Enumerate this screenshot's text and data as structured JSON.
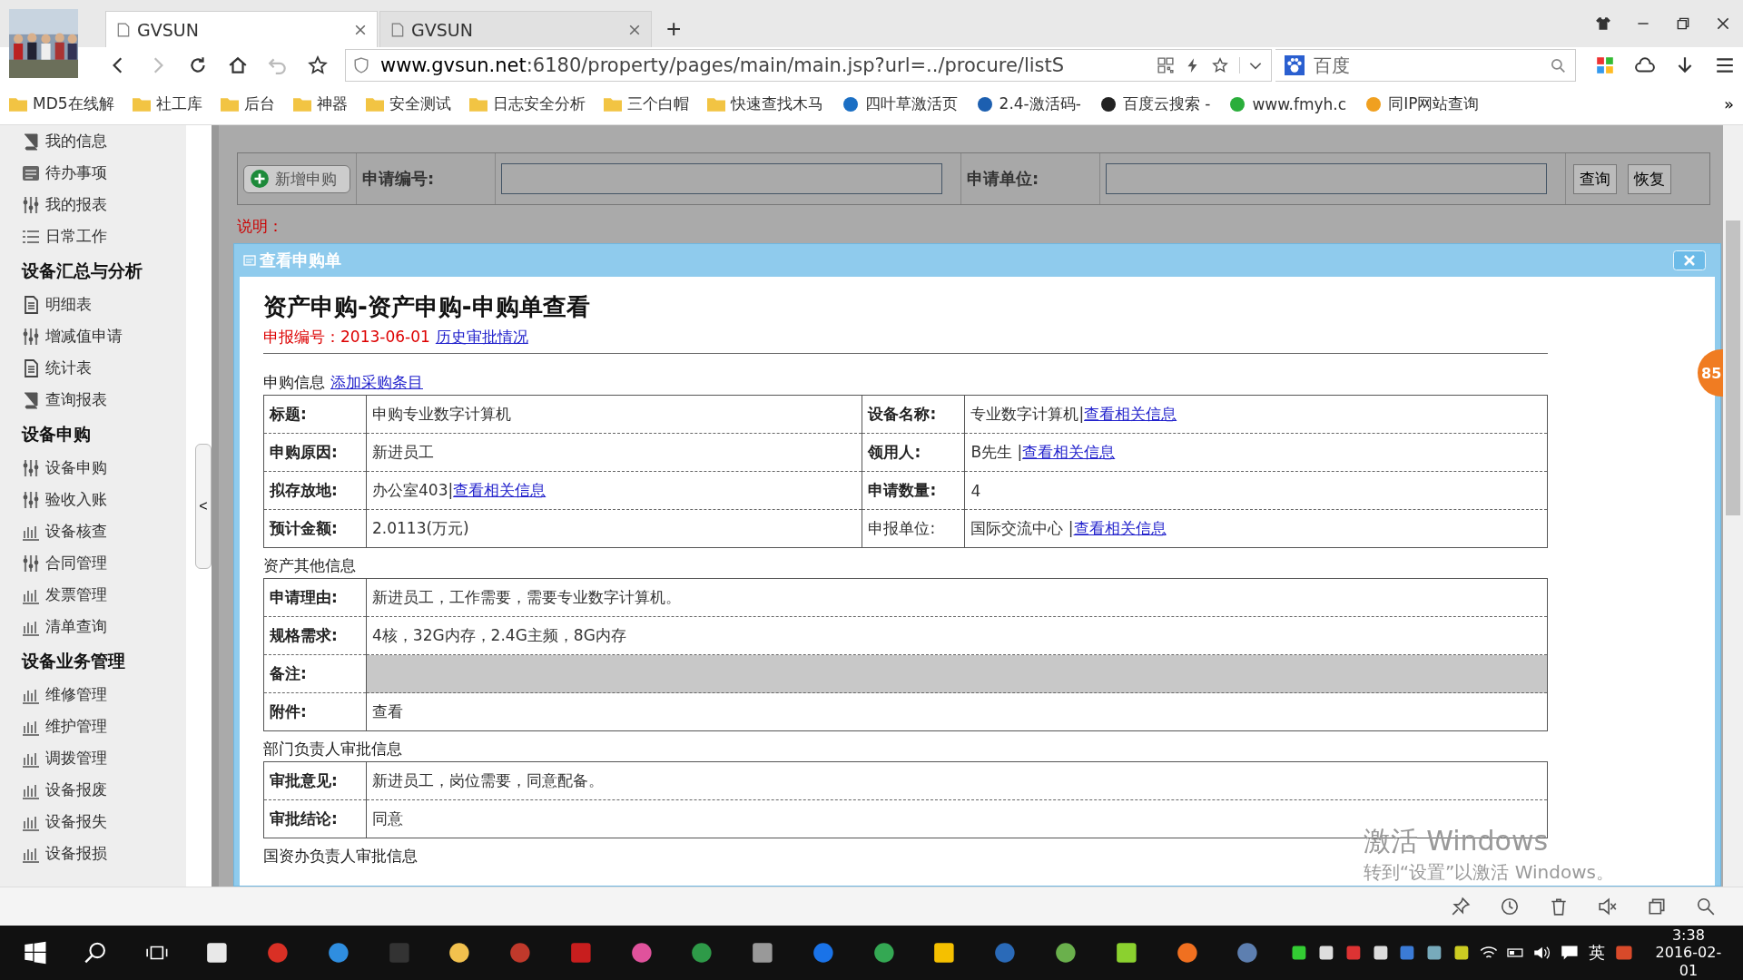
{
  "browser": {
    "tabs": [
      {
        "title": "GVSUN",
        "selected": true
      },
      {
        "title": "GVSUN",
        "selected": false
      }
    ],
    "new_tab": "+",
    "address": {
      "host": "www.gvsun.net",
      "path": ":6180/property/pages/main/main.jsp?url=../procure/listS"
    },
    "search": {
      "value": "百度"
    },
    "bookmarks": [
      {
        "label": "MD5在线解",
        "kind": "folder"
      },
      {
        "label": "社工库",
        "kind": "folder"
      },
      {
        "label": "后台",
        "kind": "folder"
      },
      {
        "label": "神器",
        "kind": "folder"
      },
      {
        "label": "安全测试",
        "kind": "folder"
      },
      {
        "label": "日志安全分析",
        "kind": "folder"
      },
      {
        "label": "三个白帽",
        "kind": "folder"
      },
      {
        "label": "快速查找木马",
        "kind": "folder"
      },
      {
        "label": "四叶草激活页",
        "kind": "site"
      },
      {
        "label": "2.4-激活码-",
        "kind": "site"
      },
      {
        "label": "百度云搜索 -",
        "kind": "site"
      },
      {
        "label": "www.fmyh.c",
        "kind": "site"
      },
      {
        "label": "同IP网站查询",
        "kind": "site"
      }
    ],
    "more": "»"
  },
  "sidebar": {
    "groups": [
      {
        "items": [
          "我的信息",
          "待办事项",
          "我的报表",
          "日常工作"
        ]
      },
      {
        "heading": "设备汇总与分析",
        "items": [
          "明细表",
          "增减值申请",
          "统计表",
          "查询报表"
        ]
      },
      {
        "heading": "设备申购",
        "items": [
          "设备申购",
          "验收入账",
          "设备核查",
          "合同管理",
          "发票管理",
          "清单查询"
        ]
      },
      {
        "heading": "设备业务管理",
        "items": [
          "维修管理",
          "维护管理",
          "调拨管理",
          "设备报废",
          "设备报失",
          "设备报损"
        ]
      }
    ],
    "collapse": "<"
  },
  "filter": {
    "add_button": "新增申购",
    "fields": [
      {
        "label": "申请编号:"
      },
      {
        "label": "申请单位:"
      }
    ],
    "buttons": [
      "查询",
      "恢复"
    ]
  },
  "note_label": "说明：",
  "dialog": {
    "title": "查看申购单",
    "heading": "资产申购-资产申购-申购单查看",
    "code": "申报编号：2013-06-01",
    "history_link": "历史审批情况",
    "sections": [
      {
        "kind": "grid4",
        "title": "申购信息",
        "link": "添加采购条目",
        "rows": [
          {
            "cells": [
              {
                "label": "标题:",
                "bold": true,
                "value": "申购专业数字计算机"
              },
              {
                "label": "设备名称:",
                "bold": true,
                "value": "专业数字计算机|",
                "link": "查看相关信息"
              }
            ]
          },
          {
            "cells": [
              {
                "label": "申购原因:",
                "bold": true,
                "value": "新进员工"
              },
              {
                "label": "领用人:",
                "bold": true,
                "value": "B先生 |",
                "link": "查看相关信息"
              }
            ]
          },
          {
            "cells": [
              {
                "label": "拟存放地:",
                "bold": true,
                "value": "办公室403|",
                "link": "查看相关信息"
              },
              {
                "label": "申请数量:",
                "bold": true,
                "value": "4"
              }
            ]
          },
          {
            "cells": [
              {
                "label": "预计金额:",
                "bold": true,
                "value": "2.0113(万元)"
              },
              {
                "label": "申报单位:",
                "bold": false,
                "value": "国际交流中心 |",
                "link": "查看相关信息"
              }
            ]
          }
        ]
      },
      {
        "kind": "grid2",
        "title": "资产其他信息",
        "rows": [
          {
            "label": "申请理由:",
            "value": "新进员工，工作需要，需要专业数字计算机。",
            "shaded": false
          },
          {
            "label": "规格需求:",
            "value": "4核，32G内存，2.4G主频，8G内存",
            "shaded": false
          },
          {
            "label": "备注:",
            "shaded": true
          },
          {
            "label": "附件:",
            "value": "查看",
            "shaded": false
          }
        ]
      },
      {
        "kind": "grid2",
        "title": "部门负责人审批信息",
        "rows": [
          {
            "label": "审批意见:",
            "value": "新进员工，岗位需要，同意配备。",
            "shaded": false
          },
          {
            "label": "审批结论:",
            "value": "同意",
            "shaded": false
          }
        ]
      },
      {
        "kind": "heading",
        "title": "国资办负责人审批信息"
      }
    ]
  },
  "side_badge": "85",
  "activation": {
    "title": "激活 Windows",
    "hint": "转到“设置”以激活 Windows。"
  },
  "taskbar": {
    "ime": "英",
    "time": "3:38",
    "date": "2016-02-01"
  }
}
